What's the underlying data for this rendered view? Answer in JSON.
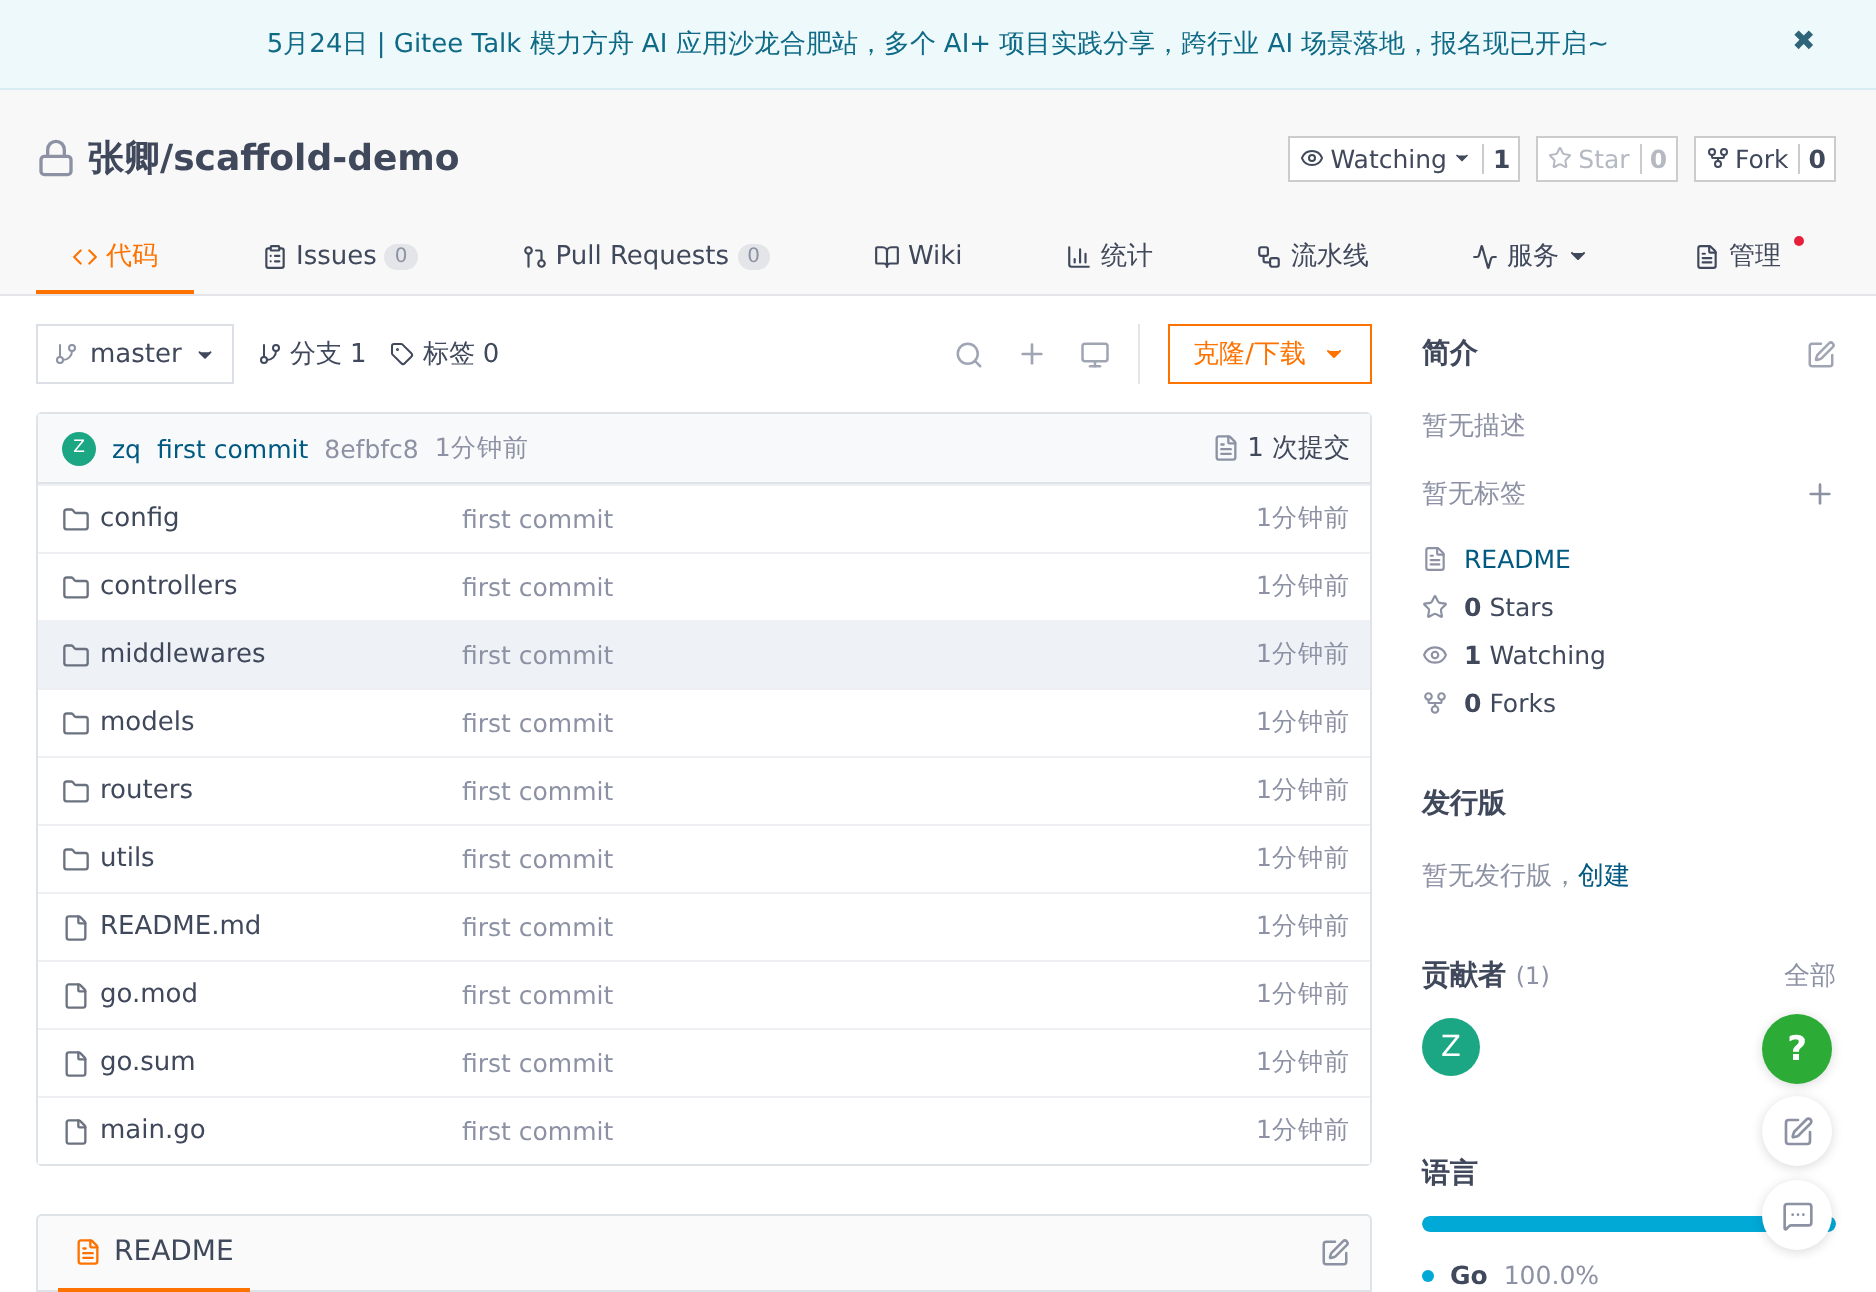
{
  "banner": {
    "text": "5月24日 | Gitee Talk 模力方舟 AI 应用沙龙合肥站，多个 AI+ 项目实践分享，跨行业 AI 场景落地，报名现已开启~",
    "close": "✖"
  },
  "repo": {
    "title": "张卿/scaffold-demo",
    "private": true,
    "actions": [
      {
        "label": "Watching",
        "count": "1",
        "dropdown": true,
        "disabled": false
      },
      {
        "label": "Star",
        "count": "0",
        "dropdown": false,
        "disabled": true
      },
      {
        "label": "Fork",
        "count": "0",
        "dropdown": false,
        "disabled": false
      }
    ]
  },
  "tabs": [
    {
      "label": "代码",
      "selected": true
    },
    {
      "label": "Issues",
      "count": "0",
      "selected": false
    },
    {
      "label": "Pull Requests",
      "count": "0",
      "selected": false
    },
    {
      "label": "Wiki",
      "selected": false
    },
    {
      "label": "统计",
      "selected": false
    },
    {
      "label": "流水线",
      "selected": false
    },
    {
      "label": "服务",
      "dropdown": true,
      "selected": false
    },
    {
      "label": "管理",
      "notice": true,
      "selected": false
    }
  ],
  "toolbar": {
    "branch": "master",
    "branches": "分支 1",
    "tags": "标签 0",
    "clone": "克隆/下载"
  },
  "commit": {
    "avatar": "Z",
    "author": "zq",
    "message": "first commit",
    "hash": "8efbfc8",
    "time": "1分钟前",
    "count": "1 次提交"
  },
  "files": [
    {
      "kind": "folder",
      "name": "config",
      "message": "first commit",
      "time": "1分钟前",
      "highlighted": false
    },
    {
      "kind": "folder",
      "name": "controllers",
      "message": "first commit",
      "time": "1分钟前",
      "highlighted": false
    },
    {
      "kind": "folder",
      "name": "middlewares",
      "message": "first commit",
      "time": "1分钟前",
      "highlighted": true
    },
    {
      "kind": "folder",
      "name": "models",
      "message": "first commit",
      "time": "1分钟前",
      "highlighted": false
    },
    {
      "kind": "folder",
      "name": "routers",
      "message": "first commit",
      "time": "1分钟前",
      "highlighted": false
    },
    {
      "kind": "folder",
      "name": "utils",
      "message": "first commit",
      "time": "1分钟前",
      "highlighted": false
    },
    {
      "kind": "file",
      "name": "README.md",
      "message": "first commit",
      "time": "1分钟前",
      "highlighted": false
    },
    {
      "kind": "file",
      "name": "go.mod",
      "message": "first commit",
      "time": "1分钟前",
      "highlighted": false
    },
    {
      "kind": "file",
      "name": "go.sum",
      "message": "first commit",
      "time": "1分钟前",
      "highlighted": false
    },
    {
      "kind": "file",
      "name": "main.go",
      "message": "first commit",
      "time": "1分钟前",
      "highlighted": false
    }
  ],
  "readme": {
    "title": "README"
  },
  "sidebar": {
    "intro_title": "简介",
    "description": "暂无描述",
    "tags": "暂无标签",
    "readme": "README",
    "stats": [
      {
        "count": "0",
        "label": "Stars"
      },
      {
        "count": "1",
        "label": "Watching"
      },
      {
        "count": "0",
        "label": "Forks"
      }
    ],
    "release_title": "发行版",
    "release_text": "暂无发行版，",
    "release_link": "创建",
    "contributors_title": "贡献者",
    "contributors_count": "(1)",
    "contributors_all": "全部",
    "contributors": [
      "Z"
    ],
    "language_title": "语言",
    "languages": [
      {
        "name": "Go",
        "percent": "100.0%",
        "level": 1,
        "color": "#00a9d6"
      }
    ]
  },
  "floating": {
    "help": "?"
  }
}
